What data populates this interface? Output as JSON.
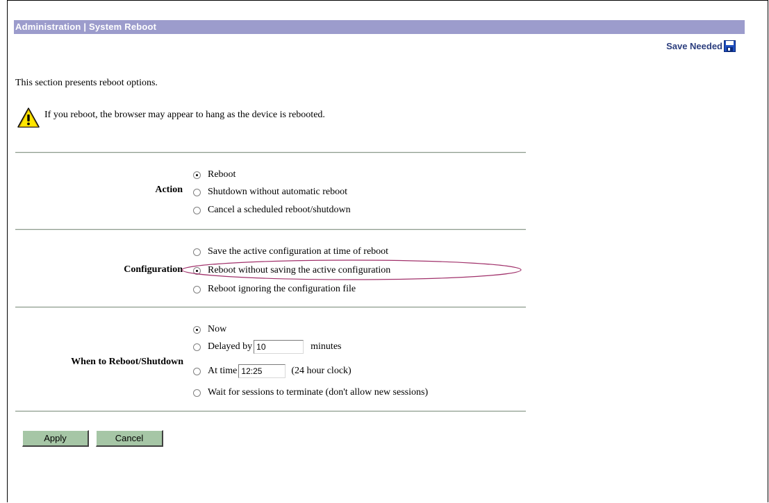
{
  "header": {
    "title": "Administration | System Reboot",
    "save_needed": "Save Needed"
  },
  "intro_text": "This section presents reboot options.",
  "warning_text": "If you reboot, the browser may appear to hang as the device is rebooted.",
  "action": {
    "label": "Action",
    "options": [
      "Reboot",
      "Shutdown without automatic reboot",
      "Cancel a scheduled reboot/shutdown"
    ],
    "selected": 0
  },
  "configuration": {
    "label": "Configuration",
    "options": [
      "Save the active configuration at time of reboot",
      "Reboot without saving the active configuration",
      "Reboot ignoring the configuration file"
    ],
    "selected": 1
  },
  "when": {
    "label": "When to Reboot/Shutdown",
    "now": "Now",
    "delayed_prefix": "Delayed by",
    "delayed_value": "10",
    "delayed_suffix": "minutes",
    "at_time_prefix": "At time",
    "at_time_value": "12:25",
    "at_time_suffix": "(24 hour clock)",
    "wait": "Wait for sessions to terminate (don't allow new sessions)",
    "selected": 0
  },
  "buttons": {
    "apply": "Apply",
    "cancel": "Cancel"
  },
  "colors": {
    "title_bar": "#9c9ccc",
    "button": "#a6c6a6",
    "annotation": "#a0306a"
  }
}
